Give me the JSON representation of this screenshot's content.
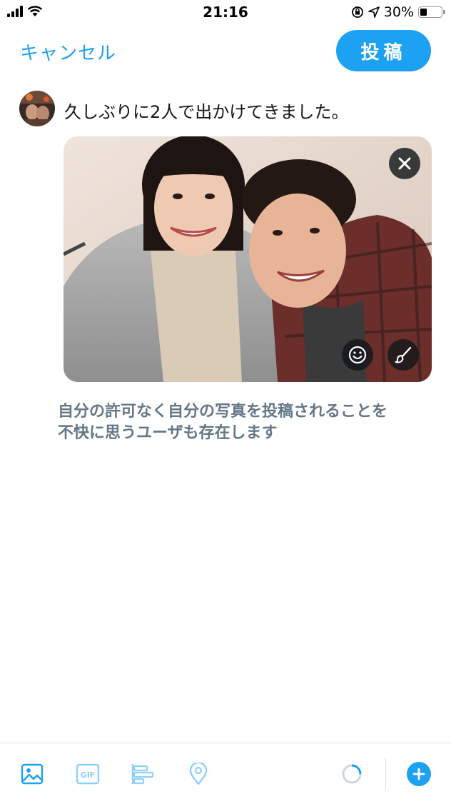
{
  "status_bar": {
    "time": "21:16",
    "battery": "30%"
  },
  "header": {
    "cancel_label": "キャンセル",
    "post_label": "投稿"
  },
  "compose": {
    "text": "久しぶりに2人で出かけてきました。"
  },
  "warning": {
    "line1": "自分の許可なく自分の写真を投稿されることを",
    "line2": "不快に思うユーザも存在します"
  },
  "colors": {
    "accent": "#1da1f2",
    "warning_text": "#657786",
    "icon_light": "#8ed0f9"
  },
  "toolbar": {
    "icons": [
      "image-icon",
      "gif-icon",
      "poll-icon",
      "location-icon",
      "progress-ring-icon",
      "add-icon"
    ],
    "gif_label": "GIF"
  }
}
